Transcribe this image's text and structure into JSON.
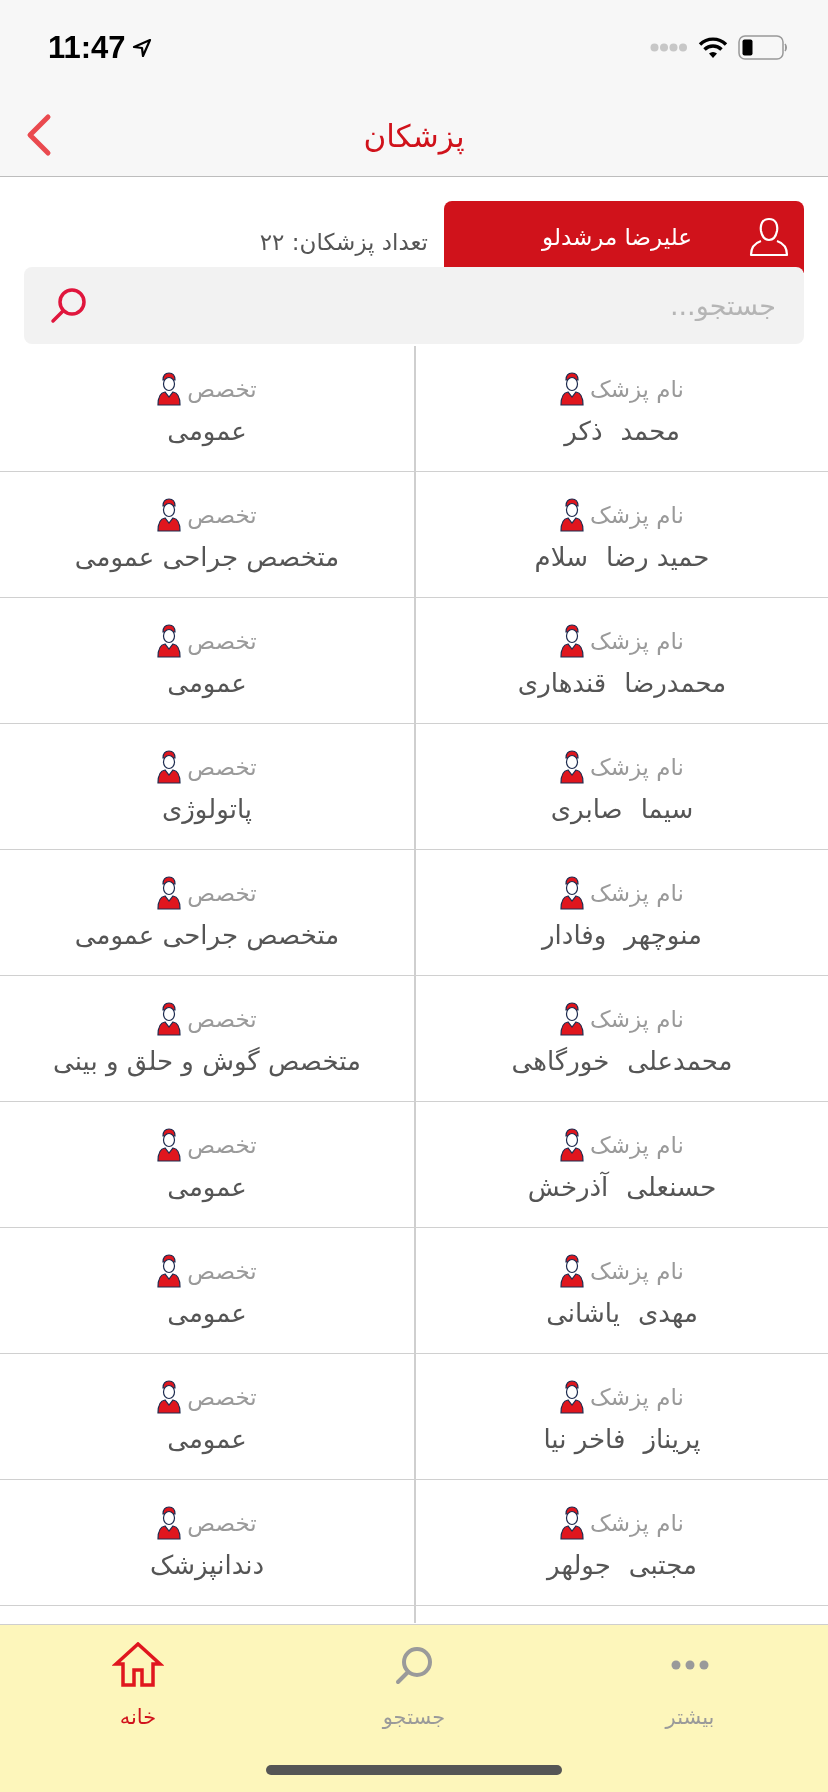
{
  "status_bar": {
    "time": "11:47"
  },
  "nav": {
    "title": "پزشکان"
  },
  "user": {
    "name": "علیرضا مرشدلو"
  },
  "count": "تعداد پزشکان: ۲۲",
  "search": {
    "placeholder": "جستجو..."
  },
  "doctors": [
    {
      "name_label": "نام پزشک",
      "first_name": "محمد",
      "last_name": "ذکر",
      "specialty_label": "تخصص",
      "specialty": "عمومی"
    },
    {
      "name_label": "نام پزشک",
      "first_name": "حمید رضا",
      "last_name": "سلام",
      "specialty_label": "تخصص",
      "specialty": "متخصص جراحی عمومی"
    },
    {
      "name_label": "نام پزشک",
      "first_name": "محمدرضا",
      "last_name": "قندهاری",
      "specialty_label": "تخصص",
      "specialty": "عمومی"
    },
    {
      "name_label": "نام پزشک",
      "first_name": "سیما",
      "last_name": "صابری",
      "specialty_label": "تخصص",
      "specialty": "پاتولوژی"
    },
    {
      "name_label": "نام پزشک",
      "first_name": "منوچهر",
      "last_name": "وفادار",
      "specialty_label": "تخصص",
      "specialty": "متخصص جراحی عمومی"
    },
    {
      "name_label": "نام پزشک",
      "first_name": "محمدعلی",
      "last_name": "خورگاهی",
      "specialty_label": "تخصص",
      "specialty": "متخصص گوش و حلق و بینی"
    },
    {
      "name_label": "نام پزشک",
      "first_name": "حسنعلی",
      "last_name": "آذرخش",
      "specialty_label": "تخصص",
      "specialty": "عمومی"
    },
    {
      "name_label": "نام پزشک",
      "first_name": "مهدی",
      "last_name": "یاشانی",
      "specialty_label": "تخصص",
      "specialty": "عمومی"
    },
    {
      "name_label": "نام پزشک",
      "first_name": "پریناز",
      "last_name": "فاخر نیا",
      "specialty_label": "تخصص",
      "specialty": "عمومی"
    },
    {
      "name_label": "نام پزشک",
      "first_name": "مجتبی",
      "last_name": "جولهر",
      "specialty_label": "تخصص",
      "specialty": "دندانپزشک"
    }
  ],
  "tabs": [
    {
      "kind": "more",
      "label": "بیشتر",
      "selected": false
    },
    {
      "kind": "search",
      "label": "جستجو",
      "selected": false
    },
    {
      "kind": "home",
      "label": "خانه",
      "selected": true
    }
  ]
}
